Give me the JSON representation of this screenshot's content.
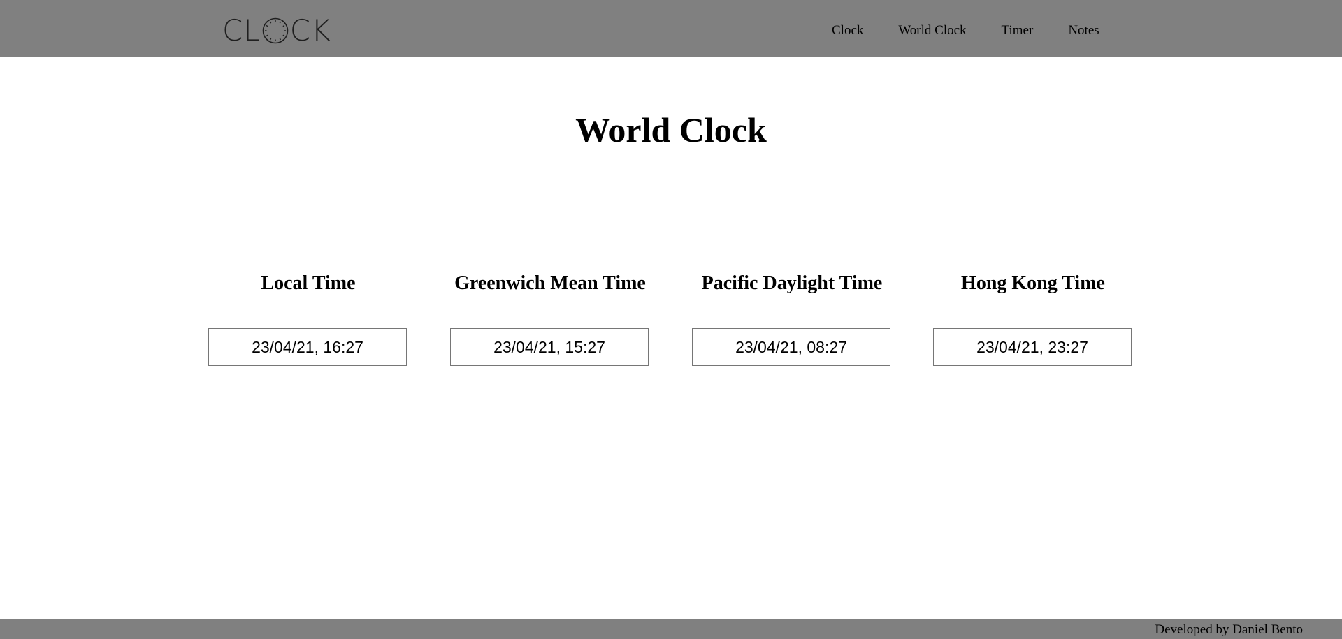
{
  "header": {
    "logo_text": "CLOCK",
    "logo_letters": [
      "C",
      "L",
      "C",
      "K"
    ],
    "nav": [
      {
        "label": "Clock"
      },
      {
        "label": "World Clock"
      },
      {
        "label": "Timer"
      },
      {
        "label": "Notes"
      }
    ]
  },
  "main": {
    "title": "World Clock",
    "zones": [
      {
        "name": "Local Time",
        "value": "23/04/21, 16:27"
      },
      {
        "name": "Greenwich Mean Time",
        "value": "23/04/21, 15:27"
      },
      {
        "name": "Pacific Daylight Time",
        "value": "23/04/21, 08:27"
      },
      {
        "name": "Hong Kong Time",
        "value": "23/04/21, 23:27"
      }
    ]
  },
  "footer": {
    "credit": "Developed by Daniel Bento"
  },
  "colors": {
    "header_bg": "#808080",
    "footer_bg": "#808080",
    "page_bg": "#ffffff"
  },
  "icons": {
    "logo_o": "clock-face-icon"
  }
}
